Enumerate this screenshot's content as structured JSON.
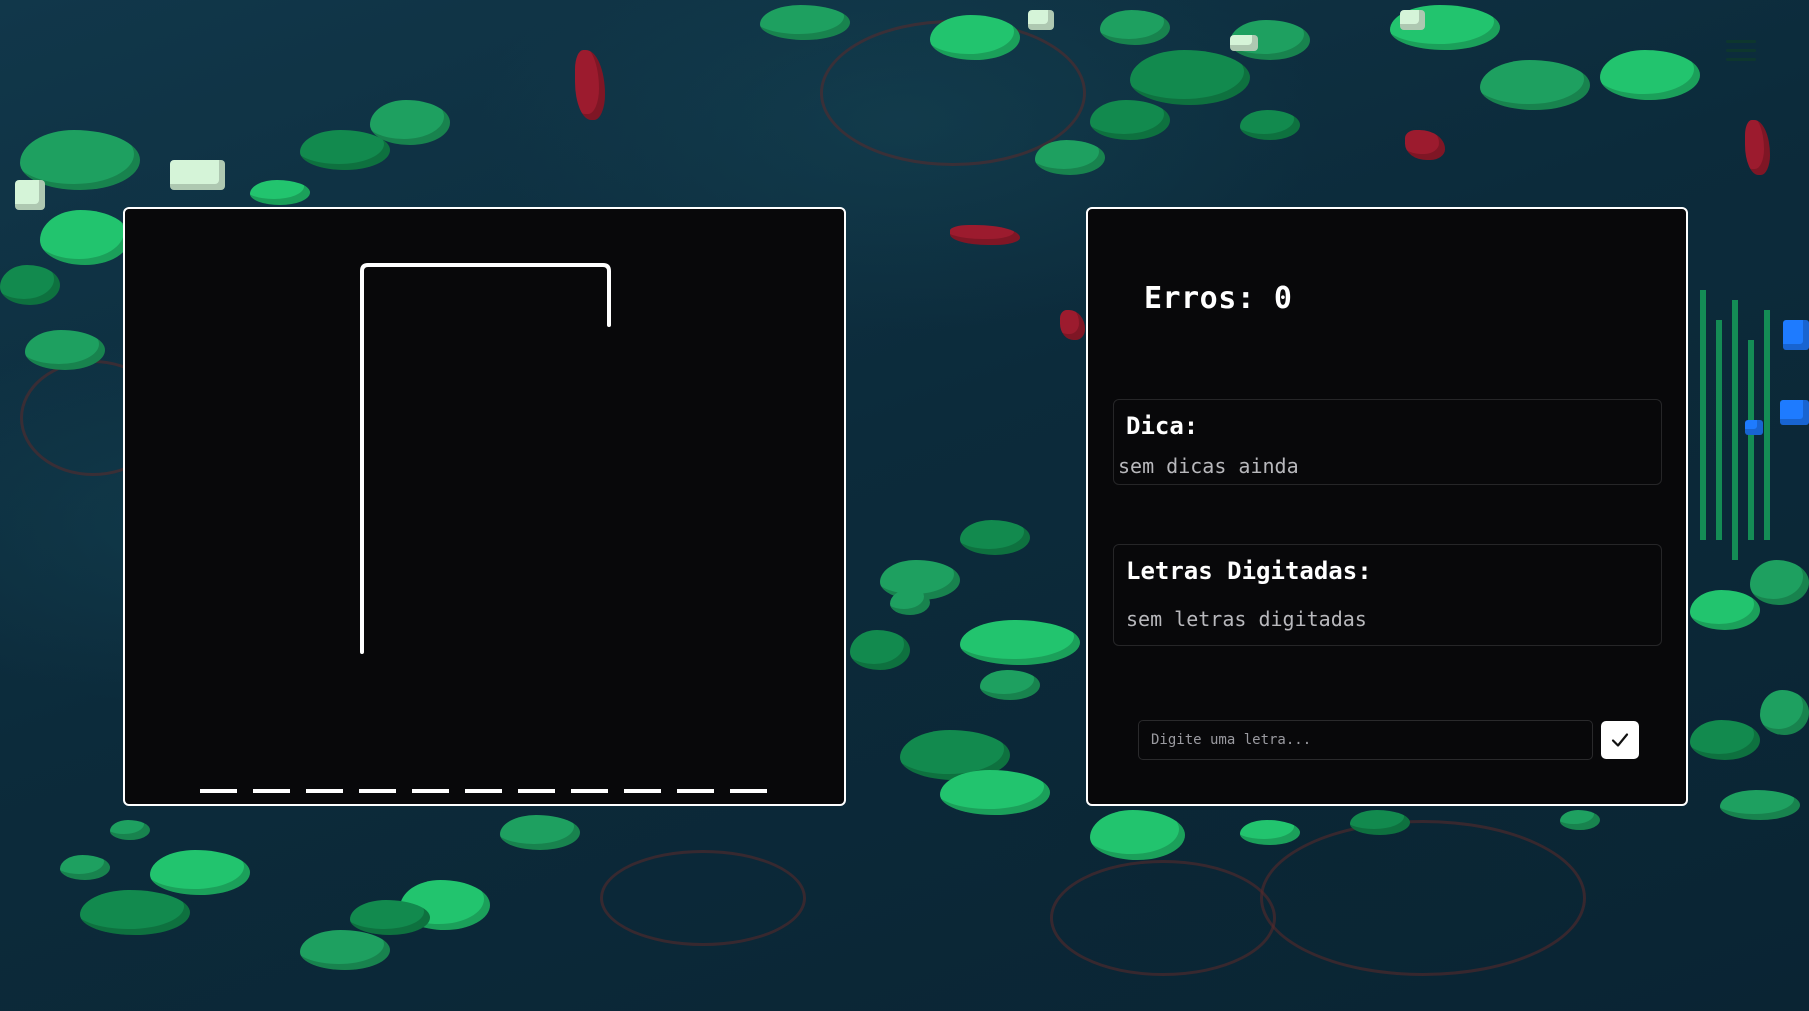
{
  "game": {
    "errors_label": "Erros: 0",
    "errors_count": 0,
    "word_length": 11
  },
  "hint": {
    "title": "Dica:",
    "text": "sem dicas ainda"
  },
  "letters": {
    "title": "Letras Digitadas:",
    "text": "sem letras digitadas"
  },
  "input": {
    "placeholder": "Digite uma letra...",
    "value": ""
  },
  "submit": {
    "icon": "check-icon"
  },
  "menu": {
    "icon": "hamburger-menu-icon"
  },
  "colors": {
    "panel_bg": "#08080a",
    "panel_border": "#ffffff",
    "muted_text": "#b8b8bc",
    "background": "#0d2b3a"
  }
}
